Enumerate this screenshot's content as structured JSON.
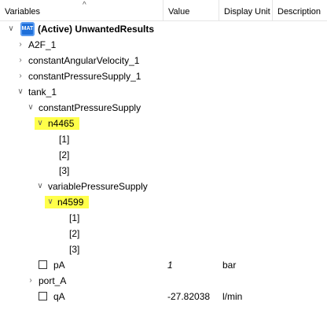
{
  "columns": {
    "variables": "Variables",
    "value": "Value",
    "display_unit": "Display Unit",
    "description": "Description"
  },
  "tree": {
    "root_icon_text": "MAT",
    "root_label": "(Active) UnwantedResults",
    "a2f": "A2F_1",
    "cav": "constantAngularVelocity_1",
    "cps": "constantPressureSupply_1",
    "tank": "tank_1",
    "tank_cps": "constantPressureSupply",
    "n4465": "n4465",
    "idx1a": "[1]",
    "idx2a": "[2]",
    "idx3a": "[3]",
    "tank_vps": "variablePressureSupply",
    "n4599": "n4599",
    "idx1b": "[1]",
    "idx2b": "[2]",
    "idx3b": "[3]",
    "pA": "pA",
    "pA_value": "1",
    "pA_unit": "bar",
    "port_A": "port_A",
    "qA": "qA",
    "qA_value": "-27.82038",
    "qA_unit": "l/min"
  },
  "colors": {
    "highlight": "#ffff4a",
    "mat_icon": "#1e6fd9"
  }
}
